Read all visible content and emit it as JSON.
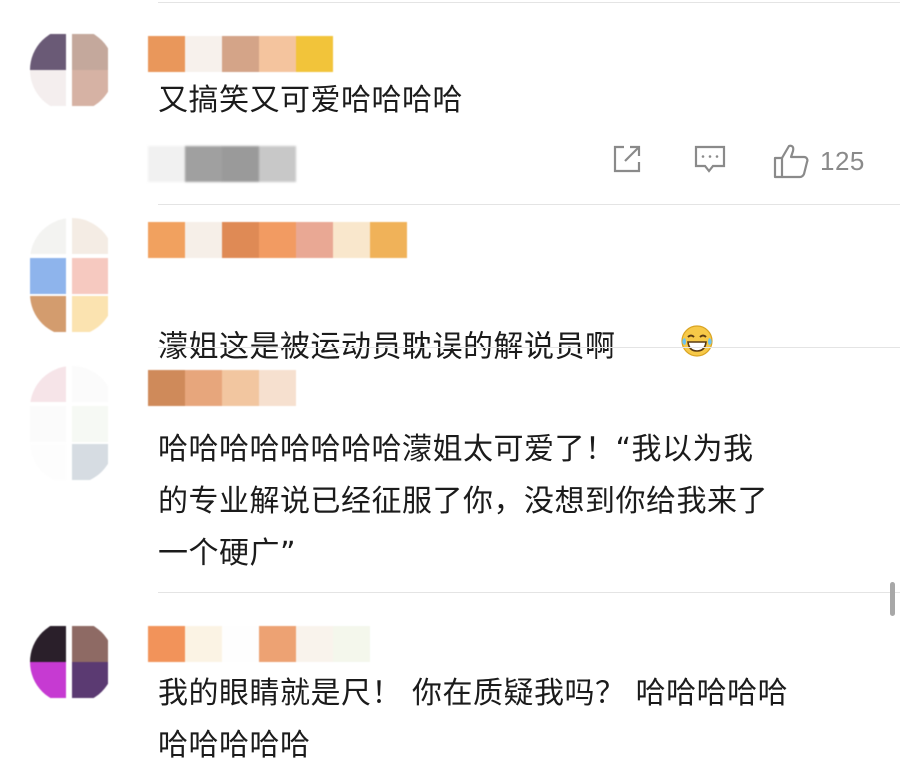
{
  "comments": [
    {
      "text": "又搞笑又可爱哈哈哈哈",
      "actions": {
        "like_count": "125"
      }
    },
    {
      "text": "濛姐这是被运动员耽误的解说员啊",
      "emoji": "laughing-tears-emoji"
    },
    {
      "text": "哈哈哈哈哈哈哈哈濛姐太可爱了！“我以为我\n的专业解说已经征服了你，没想到你给我来了\n一个硬广”"
    },
    {
      "text": "我的眼睛就是尺！ 你在质疑我吗？ 哈哈哈哈哈\n哈哈哈哈哈"
    }
  ],
  "icons": {
    "share": "share-icon",
    "comment": "comment-icon",
    "like": "thumbs-up-icon"
  },
  "colors": {
    "text": "#1b1b1b",
    "meta": "#8a8a8a",
    "divider": "#e4e4e4"
  }
}
